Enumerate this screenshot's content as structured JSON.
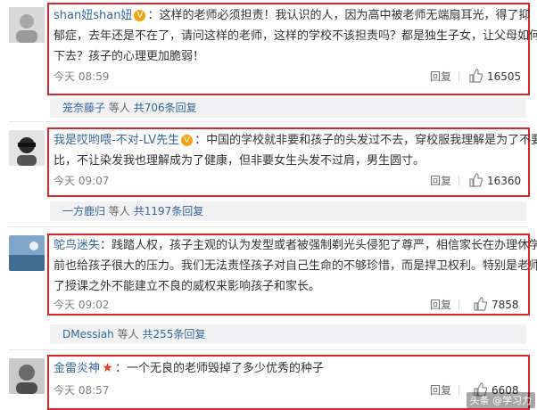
{
  "comments": [
    {
      "username": "shan妞shan妞",
      "badge": "V",
      "lines": [
        "：这样的老师必须担责！我认识的人，因为高中被老师无端扇耳光，得了抑",
        "郁症，去年还是不在了，请问这样的老师，这样的学校不该担责吗？都是独生子女，让父母如何活",
        "下去？孩子的心理更加脆弱！"
      ],
      "time": "今天 08:59",
      "reply_label": "回复",
      "likes": "16505",
      "sub_user": "笼奈藤子",
      "sub_text": "等人",
      "sub_count": "共706条回复"
    },
    {
      "username": "我是哎哟喂-不对-LV先生",
      "badge": "V",
      "lines": [
        "：中国的学校就非要和孩子的头发过不去，穿校服我理解是为了不要攀",
        "比，不让染发我也理解成为了健康，但非要女生头发不过肩，男生圆寸。"
      ],
      "time": "今天 09:07",
      "reply_label": "回复",
      "likes": "16360",
      "sub_user": "一方鹿归",
      "sub_text": "等人",
      "sub_count": "共1197条回复"
    },
    {
      "username": "鸵鸟迷失",
      "lines": [
        "：践踏人权，孩子主观的认为发型或者被强制剃光头侵犯了尊严，相信家长在办理休学之",
        "前也给孩子很大的压力。我们无法责怪孩子对自己生命的不够珍惜，而是捍卫权利。特别是老师除",
        "了授课之外不能建立不良的威权来影响孩子和家长。"
      ],
      "time": "今天 09:02",
      "reply_label": "回复",
      "likes": "7858",
      "sub_user": "DMessiah",
      "sub_text": "等人",
      "sub_count": "共255条回复"
    },
    {
      "username": "金雷炎神",
      "badge": "★",
      "lines": [
        "：一个无良的老师毁掉了多少优秀的种子"
      ],
      "time": "今天 08:57",
      "reply_label": "回复",
      "likes": "6608"
    }
  ],
  "watermark": "头条 @学习力",
  "colors": {
    "highlight_box": "#d9262a",
    "username": "#eb7350",
    "link": "#33669a"
  }
}
